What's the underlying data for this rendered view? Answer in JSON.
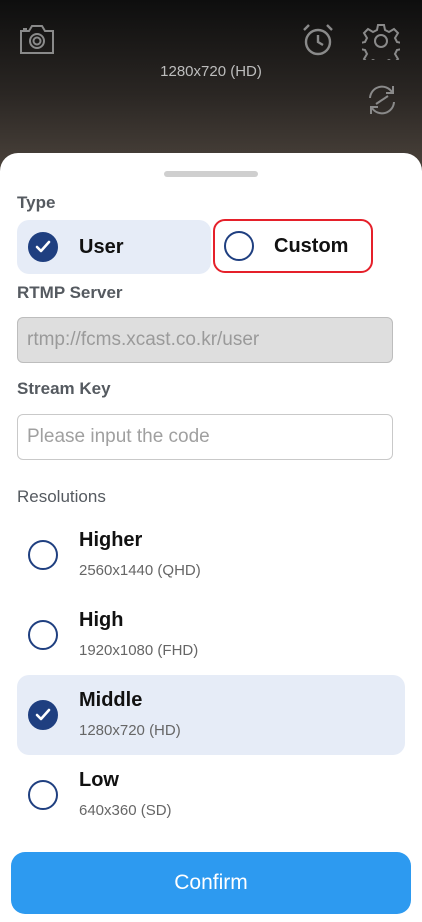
{
  "preview": {
    "resolution_label": "1280x720 (HD)",
    "icons": [
      "camera-icon",
      "alarm-icon",
      "gear-icon",
      "flip-camera-icon"
    ]
  },
  "sheet": {
    "type_label": "Type",
    "type_options": [
      {
        "label": "User",
        "selected": true
      },
      {
        "label": "Custom",
        "selected": false
      }
    ],
    "rtmp_label": "RTMP Server",
    "rtmp_placeholder": "rtmp://fcms.xcast.co.kr/user",
    "stream_key_label": "Stream Key",
    "stream_key_placeholder": "Please input the code",
    "resolutions_label": "Resolutions",
    "resolutions": [
      {
        "name": "Higher",
        "detail": "2560x1440 (QHD)",
        "selected": false
      },
      {
        "name": "High",
        "detail": "1920x1080 (FHD)",
        "selected": false
      },
      {
        "name": "Middle",
        "detail": "1280x720 (HD)",
        "selected": true
      },
      {
        "name": "Low",
        "detail": "640x360 (SD)",
        "selected": false
      }
    ],
    "confirm_label": "Confirm"
  },
  "colors": {
    "accent": "#2d9af0",
    "radio": "#1f3f80",
    "selected_bg": "#e6ecf7",
    "highlight_border": "#e5202a"
  }
}
